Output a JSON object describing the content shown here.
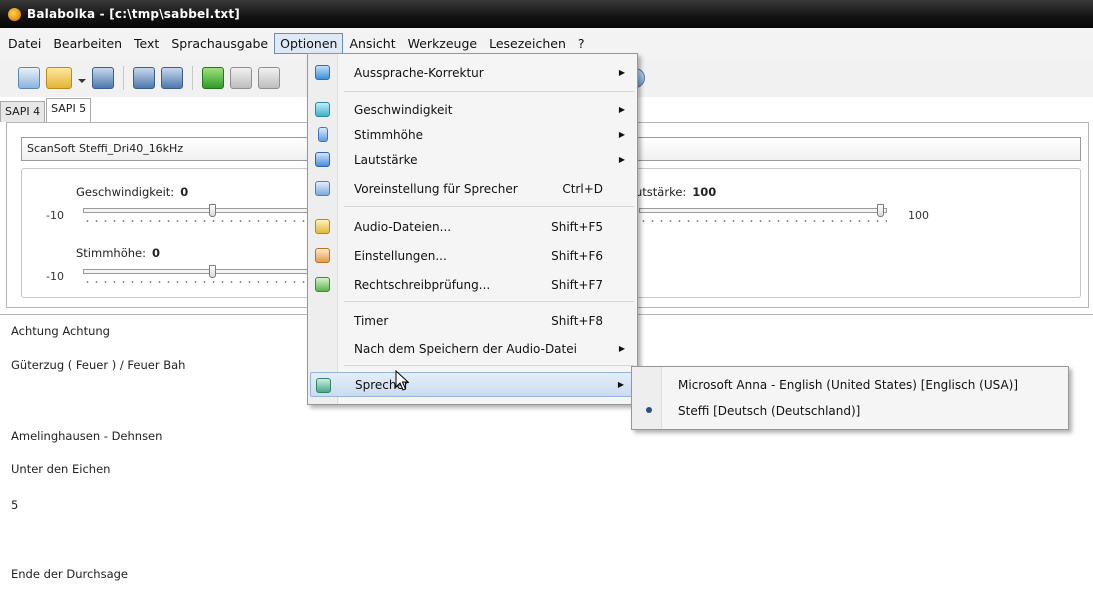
{
  "window": {
    "title": "Balabolka - [c:\\tmp\\sabbel.txt]"
  },
  "menubar": {
    "items": [
      "Datei",
      "Bearbeiten",
      "Text",
      "Sprachausgabe",
      "Optionen",
      "Ansicht",
      "Werkzeuge",
      "Lesezeichen",
      "?"
    ],
    "active": "Optionen"
  },
  "tabs": [
    "SAPI 4",
    "SAPI 5"
  ],
  "voice": {
    "selected": "ScanSoft Steffi_Dri40_16kHz"
  },
  "controls": {
    "speed": {
      "label": "Geschwindigkeit:",
      "value": "0",
      "min": "-10"
    },
    "pitch": {
      "label": "Stimmhöhe:",
      "value": "0",
      "min": "-10"
    },
    "volume": {
      "label": "utstärke:",
      "value": "100",
      "max": "100"
    }
  },
  "options_menu": {
    "items": [
      {
        "label": "Aussprache-Korrektur",
        "shortcut": "",
        "submenu": true,
        "icon": "pronunciation-icon"
      },
      {
        "label": "Geschwindigkeit",
        "shortcut": "",
        "submenu": true,
        "icon": "speed-icon"
      },
      {
        "label": "Stimmhöhe",
        "shortcut": "",
        "submenu": true,
        "icon": "microphone-icon"
      },
      {
        "label": "Lautstärke",
        "shortcut": "",
        "submenu": true,
        "icon": "speaker-icon"
      },
      {
        "label": "Voreinstellung für Sprecher",
        "shortcut": "Ctrl+D",
        "submenu": false,
        "icon": "voice-preset-icon"
      },
      {
        "label": "Audio-Dateien...",
        "shortcut": "Shift+F5",
        "submenu": false,
        "icon": "audio-files-icon"
      },
      {
        "label": "Einstellungen...",
        "shortcut": "Shift+F6",
        "submenu": false,
        "icon": "settings-icon"
      },
      {
        "label": "Rechtschreibprüfung...",
        "shortcut": "Shift+F7",
        "submenu": false,
        "icon": "spellcheck-icon"
      },
      {
        "label": "Timer",
        "shortcut": "Shift+F8",
        "submenu": false,
        "icon": ""
      },
      {
        "label": "Nach dem Speichern der Audio-Datei",
        "shortcut": "",
        "submenu": true,
        "icon": ""
      },
      {
        "label": "Sprecher",
        "shortcut": "",
        "submenu": true,
        "icon": "speakers-icon"
      }
    ]
  },
  "speaker_submenu": {
    "items": [
      {
        "label": "Microsoft Anna - English (United States) [Englisch (USA)]",
        "checked": false
      },
      {
        "label": "Steffi [Deutsch (Deutschland)]",
        "checked": true
      }
    ]
  },
  "editor": {
    "lines": [
      "Achtung   Achtung",
      "Güterzug ( Feuer ) / Feuer Bah",
      "Amelinghausen - Dehnsen",
      "Unter den Eichen",
      "5",
      "Ende der Durchsage"
    ]
  }
}
